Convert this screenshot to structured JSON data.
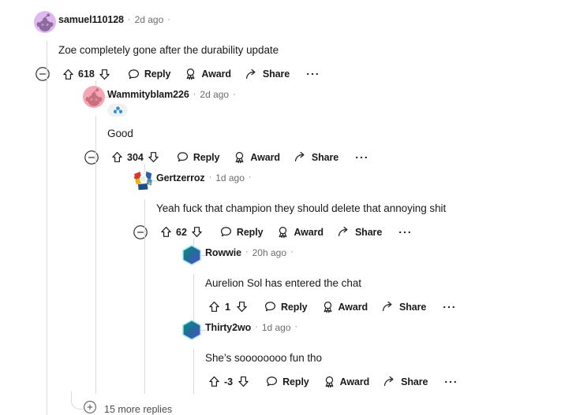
{
  "theme": {
    "background": "#ffffff",
    "text": "#1a1a1b",
    "meta_text": "#6a6d70",
    "thread_line": "#d9dadc",
    "award_pill_bg": "#eff1f3",
    "award_icon": "#2d8fd5"
  },
  "labels": {
    "reply": "Reply",
    "award": "Award",
    "share": "Share",
    "more_actions": "···",
    "separator": "·"
  },
  "icons": {
    "collapse": "minus-circle-icon",
    "upvote": "upvote-arrow-icon",
    "downvote": "downvote-arrow-icon",
    "reply": "comment-bubble-icon",
    "award": "award-medal-icon",
    "share": "share-arrow-icon",
    "more": "overflow-dots-icon",
    "expand": "plus-circle-icon"
  },
  "comments": [
    {
      "id": "c1",
      "depth": 0,
      "username": "samuel110128",
      "timestamp": "2d ago",
      "body": "Zoe completely gone after the durability update",
      "score": "618",
      "has_collapse": true,
      "avatar": {
        "name": "snoo-avatar-purple",
        "bg": "#dfb8ef",
        "fg": "#8b6b9e"
      },
      "awards": []
    },
    {
      "id": "c2",
      "depth": 1,
      "username": "Wammityblam226",
      "timestamp": "2d ago",
      "body": "Good",
      "score": "304",
      "has_collapse": true,
      "avatar": {
        "name": "snoo-avatar-pink",
        "bg": "#f5a6b4",
        "fg": "#c9707f"
      },
      "awards": [
        {
          "name": "cluster-award-badge"
        }
      ]
    },
    {
      "id": "c3",
      "depth": 2,
      "username": "Gertzerroz",
      "timestamp": "1d ago",
      "body": "Yeah fuck that champion they should delete that annoying shit",
      "score": "62",
      "has_collapse": true,
      "avatar": {
        "name": "custom-avatar-colorful",
        "bg": "#ffffff",
        "fg": "#d93a2b"
      },
      "awards": []
    },
    {
      "id": "c4",
      "depth": 3,
      "username": "Rowwie",
      "timestamp": "20h ago",
      "body": "Aurelion Sol has entered the chat",
      "score": "1",
      "has_collapse": false,
      "avatar": {
        "name": "hexagon-avatar-teal",
        "bg": "#1d7d7f",
        "fg": "#4a52c4"
      },
      "awards": []
    },
    {
      "id": "c5",
      "depth": 3,
      "username": "Thirty2wo",
      "timestamp": "1d ago",
      "body": "She’s soooooooo fun tho",
      "score": "-3",
      "has_collapse": false,
      "avatar": {
        "name": "hexagon-avatar-teal",
        "bg": "#1d7d7f",
        "fg": "#4a52c4"
      },
      "awards": []
    }
  ],
  "more_replies": {
    "label": "15 more replies",
    "count": 15
  }
}
